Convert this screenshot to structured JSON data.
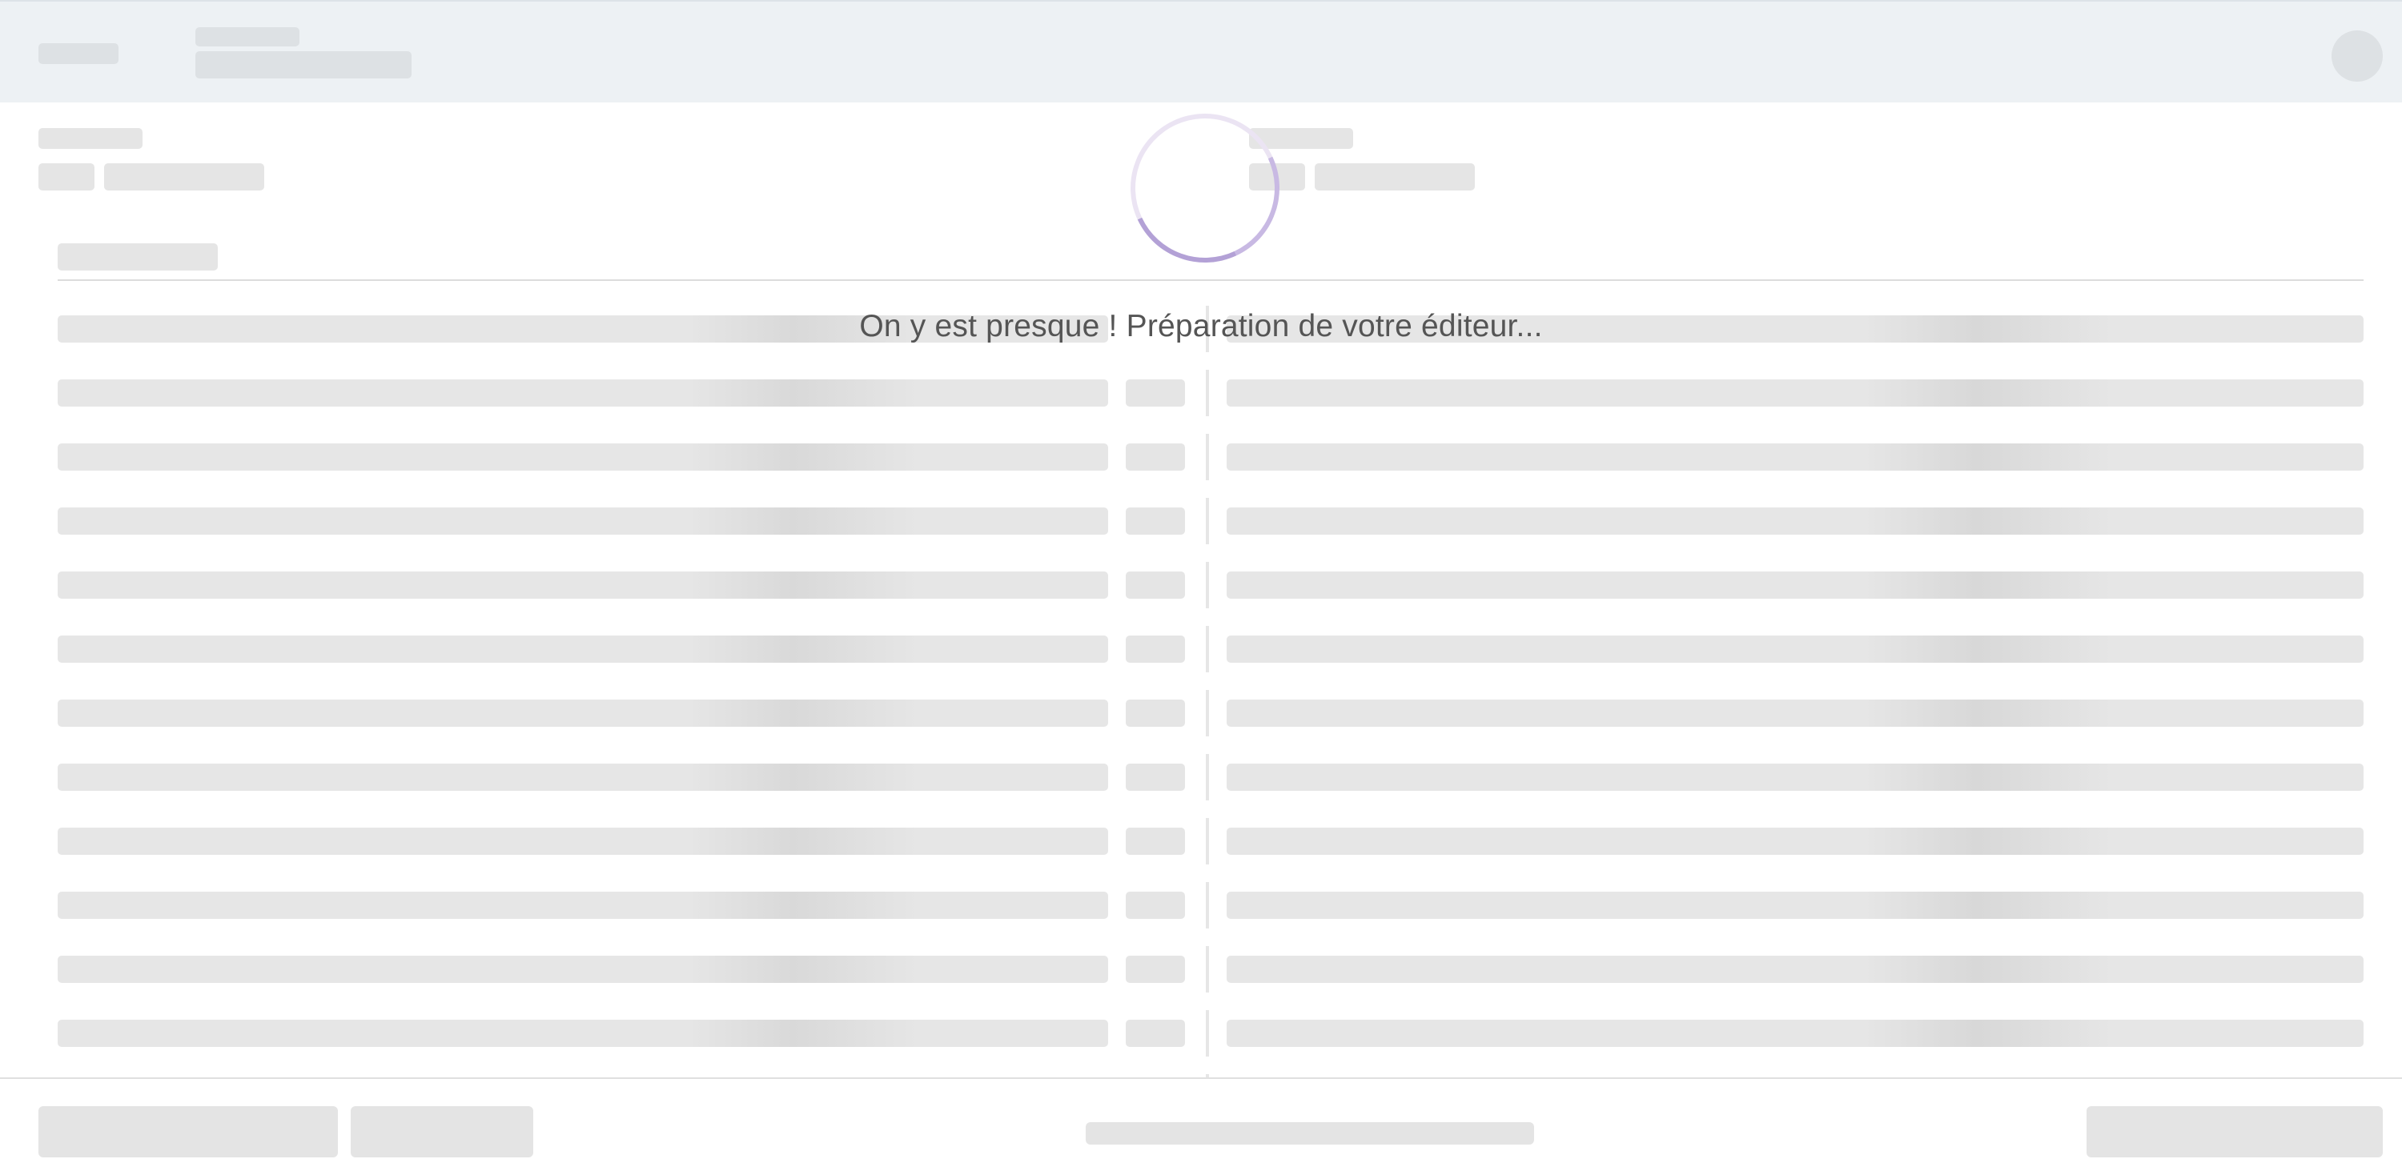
{
  "app": {
    "state": "loading"
  },
  "loading": {
    "message": "On y est presque ! Préparation de votre éditeur...",
    "spinner_color": "#b3a1d6"
  },
  "colors": {
    "header_bg": "#edf1f4",
    "skeleton": "#e5e5e5",
    "text": "#555555"
  }
}
